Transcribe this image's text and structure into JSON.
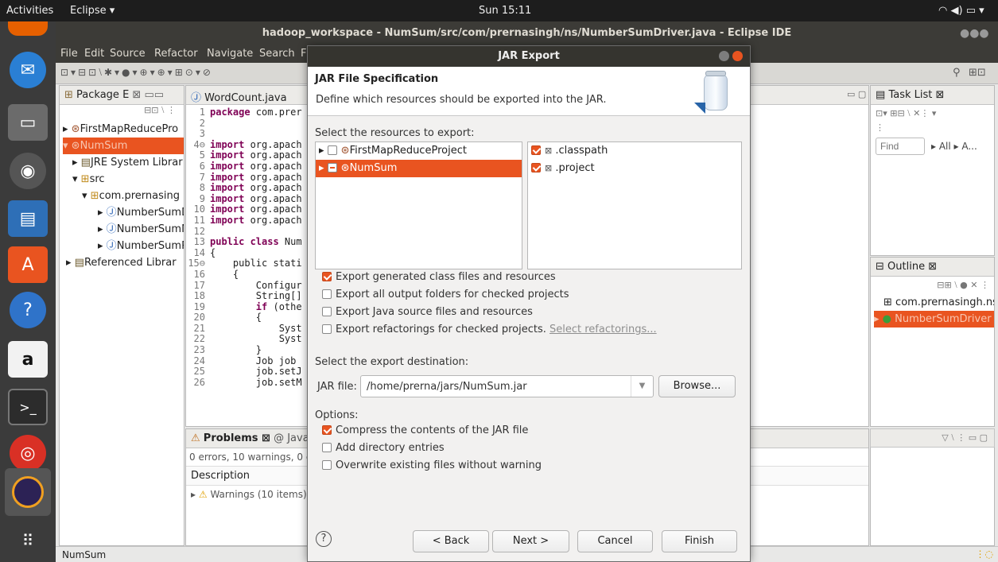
{
  "topbar": {
    "activities": "Activities",
    "app": "Eclipse ▾",
    "clock": "Sun 15:11",
    "tray": "▾"
  },
  "window": {
    "title": "hadoop_workspace - NumSum/src/com/prernasingh/ns/NumberSumDriver.java - Eclipse IDE"
  },
  "menu": [
    "File",
    "Edit",
    "Source",
    "Refactor",
    "Navigate",
    "Search",
    "F"
  ],
  "pkg": {
    "tab": "Package E",
    "items": [
      "FirstMapReducePro",
      "NumSum",
      "JRE System Librar",
      "src",
      "com.prernasing",
      "NumberSumD",
      "NumberSumM",
      "NumberSumR",
      "Referenced Librar"
    ]
  },
  "editor": {
    "tab": "WordCount.java",
    "lines": [
      {
        "n": "1",
        "t": "package com.prer"
      },
      {
        "n": "2",
        "t": ""
      },
      {
        "n": "3",
        "t": ""
      },
      {
        "n": "4⊖",
        "t": "import org.apach"
      },
      {
        "n": "5",
        "t": "import org.apach"
      },
      {
        "n": "6",
        "t": "import org.apach"
      },
      {
        "n": "7",
        "t": "import org.apach"
      },
      {
        "n": "8",
        "t": "import org.apach"
      },
      {
        "n": "9",
        "t": "import org.apach"
      },
      {
        "n": "10",
        "t": "import org.apach"
      },
      {
        "n": "11",
        "t": "import org.apach"
      },
      {
        "n": "12",
        "t": ""
      },
      {
        "n": "13",
        "t": "public class Num"
      },
      {
        "n": "14",
        "t": "{"
      },
      {
        "n": "15⊖",
        "t": "    public stati"
      },
      {
        "n": "16",
        "t": "    {"
      },
      {
        "n": "17",
        "t": "        Configur"
      },
      {
        "n": "18",
        "t": "        String[]"
      },
      {
        "n": "19",
        "t": "        if (othe"
      },
      {
        "n": "20",
        "t": "        {"
      },
      {
        "n": "21",
        "t": "            Syst"
      },
      {
        "n": "22",
        "t": "            Syst"
      },
      {
        "n": "23",
        "t": "        }"
      },
      {
        "n": "24",
        "t": "        Job job"
      },
      {
        "n": "25",
        "t": "        job.setJ"
      },
      {
        "n": "26",
        "t": "        job.setM"
      }
    ]
  },
  "problems": {
    "tab": "Problems ⊠",
    "tab2": "@ Java",
    "summary": "0 errors, 10 warnings, 0 c",
    "col": "Description",
    "row": "Warnings (10 items)"
  },
  "tasklist": {
    "tab": "Task List ⊠",
    "find_placeholder": "Find",
    "all": "▸ All ▸ A..."
  },
  "outline": {
    "tab": "Outline ⊠",
    "items": [
      "com.prernasingh.ns",
      "NumberSumDriver"
    ]
  },
  "status": {
    "text": "NumSum"
  },
  "dialog": {
    "title": "JAR Export",
    "heading": "JAR File Specification",
    "description": "Define which resources should be exported into the JAR.",
    "select_label": "Select the resources to export:",
    "projects": [
      "FirstMapReduceProject",
      "NumSum"
    ],
    "files": [
      ".classpath",
      ".project"
    ],
    "options": [
      {
        "label": "Export generated class files and resources",
        "checked": true
      },
      {
        "label": "Export all output folders for checked projects",
        "checked": false
      },
      {
        "label": "Export Java source files and resources",
        "checked": false
      },
      {
        "label": "Export refactorings for checked projects.",
        "checked": false
      }
    ],
    "select_refactorings": "Select refactorings...",
    "dest_label": "Select the export destination:",
    "jar_label": "JAR file:",
    "jar_value": "/home/prerna/jars/NumSum.jar",
    "browse": "Browse...",
    "options_label": "Options:",
    "opt2": [
      {
        "label": "Compress the contents of the JAR file",
        "checked": true
      },
      {
        "label": "Add directory entries",
        "checked": false
      },
      {
        "label": "Overwrite existing files without warning",
        "checked": false
      }
    ],
    "back": "< Back",
    "next": "Next >",
    "cancel": "Cancel",
    "finish": "Finish"
  },
  "colors": {
    "accent": "#e95420",
    "dark": "#3c3b37"
  }
}
